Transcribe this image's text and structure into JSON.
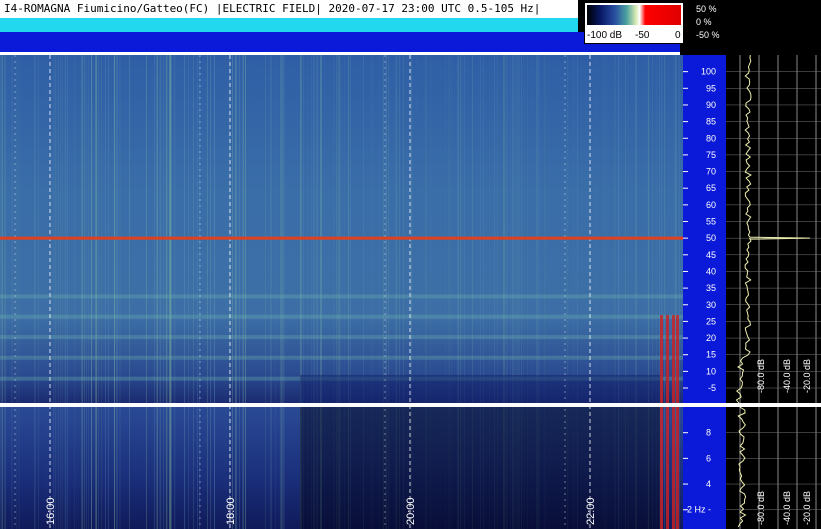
{
  "header": {
    "title": "I4-ROMAGNA Fiumicino/Gatteo(FC) |ELECTRIC FIELD| 2020-07-17 23:00 UTC 0.5-105 Hz|"
  },
  "colorbar": {
    "labels": [
      "-100 dB",
      "-50",
      "0"
    ],
    "percent_labels": [
      "50 %",
      "0 %",
      "-50 %"
    ]
  },
  "chart_data": {
    "type": "heatmap",
    "title": "I4-ROMAGNA Fiumicino/Gatteo(FC) |ELECTRIC FIELD| 2020-07-17 23:00 UTC 0.5-105 Hz|",
    "x_ticks": [
      "16:00",
      "18:00",
      "20:00",
      "22:00"
    ],
    "y_ticks_upper": [
      100,
      95,
      90,
      85,
      80,
      75,
      70,
      65,
      60,
      55,
      50,
      45,
      40,
      35,
      30,
      25,
      20,
      15,
      10,
      5
    ],
    "y_ticks_lower": [
      8,
      6,
      4,
      2
    ],
    "y_unit": "Hz",
    "ylim_upper": [
      0.5,
      105
    ],
    "ylim_lower": [
      0.5,
      10
    ],
    "colorbar_range_db": [
      -100,
      0
    ],
    "profile_ticks": [
      "-80.0 dB",
      "-40.0 dB",
      "-20.0 dB"
    ],
    "features": {
      "mains_line_hz": 50,
      "schumann_hz": [
        7.8,
        14.1,
        20.3,
        26.4,
        32.5
      ]
    }
  }
}
